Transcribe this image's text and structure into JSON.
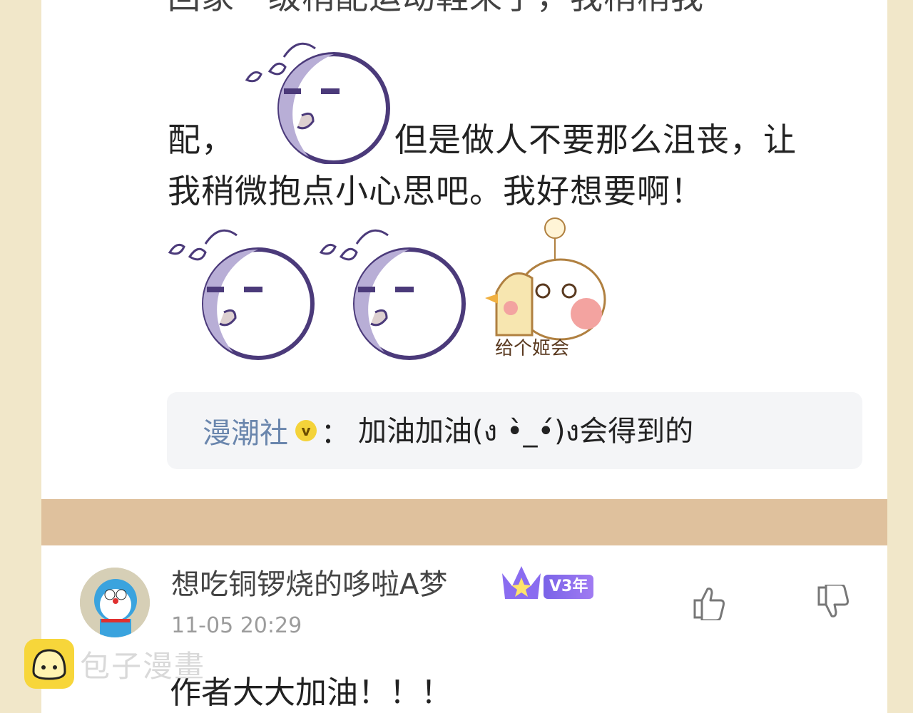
{
  "post": {
    "partial_top_line": "回家一级稍配运动鞋来了，我稍稍我",
    "line_1_start": "配，",
    "line_1_end": "但是做人不要那么沮丧，让",
    "line_2": "我稍微抱点小心思吧。我好想要啊！",
    "sticker_caption": "给个姬会"
  },
  "reply": {
    "username": "漫潮社",
    "badge_letter": "v",
    "colon": "：",
    "text": "加油加油(ง •̀_•́)ง会得到的"
  },
  "comment": {
    "username": "想吃铜锣烧的哆啦A梦",
    "level_badge": "V3年",
    "timestamp": "11-05 20:29",
    "text": "作者大大加油！！！"
  },
  "watermark": {
    "text": "包子漫畫"
  },
  "colors": {
    "reply_user": "#6a86ad",
    "separator": "#dfc19d",
    "badge_purple": "#7a63e8",
    "badge_yellow": "#f4d33a"
  }
}
